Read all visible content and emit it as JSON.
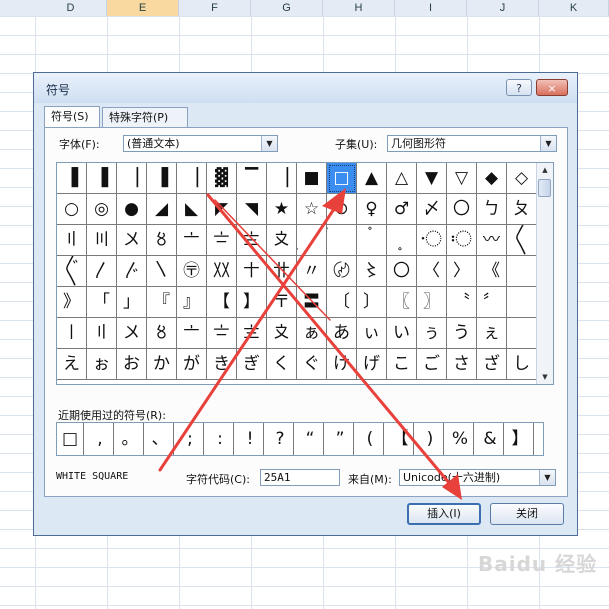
{
  "spreadsheet": {
    "columns": [
      "D",
      "E",
      "F",
      "G",
      "H",
      "I",
      "J",
      "K"
    ],
    "selected_column": "E"
  },
  "dialog": {
    "title": "符号",
    "help_button": "?",
    "close_button": "×"
  },
  "tabs": [
    {
      "label": "符号(S)",
      "active": true
    },
    {
      "label": "特殊字符(P)",
      "active": false
    }
  ],
  "font": {
    "label": "字体(F):",
    "value": "(普通文本)"
  },
  "subset": {
    "label": "子集(U):",
    "value": "几何图形符"
  },
  "symbol_grid": {
    "rows": [
      [
        "▐",
        "▐",
        "▕",
        "▐",
        "▕",
        "▓",
        "▔",
        "▕",
        "■",
        "□",
        "▲",
        "△",
        "▼",
        "▽",
        "◆",
        "◇"
      ],
      [
        "○",
        "◎",
        "●",
        "◢",
        "◣",
        "◤",
        "◥",
        "★",
        "☆",
        "⊙",
        "♀",
        "♂",
        "〆",
        "〇",
        "ㄅ",
        "ㄆ"
      ],
      [
        "〢",
        "〣",
        "〤",
        "〥",
        "〦",
        "〧",
        "〨",
        "〩",
        "〪",
        "〫",
        "〬",
        "〭",
        "〮",
        "〯",
        "〰",
        "〱"
      ],
      [
        "〲",
        "〳",
        "〴",
        "〵",
        "〶",
        "〷",
        "〸",
        "〹",
        "〃",
        "〄",
        "〻",
        "〇",
        "〈",
        "〉",
        "《",
        ""
      ],
      [
        "》",
        "「",
        "」",
        "『",
        "』",
        "【",
        "】",
        "〒",
        "〓",
        "〔",
        "〕",
        "〖",
        "〗",
        "〝",
        "〞",
        ""
      ],
      [
        "〡",
        "〢",
        "〤",
        "〥",
        "〦",
        "〧",
        "〨",
        "〩",
        "ぁ",
        "あ",
        "ぃ",
        "い",
        "ぅ",
        "う",
        "ぇ",
        ""
      ],
      [
        "え",
        "ぉ",
        "お",
        "か",
        "が",
        "き",
        "ぎ",
        "く",
        "ぐ",
        "け",
        "げ",
        "こ",
        "ご",
        "さ",
        "ざ",
        "し"
      ]
    ],
    "selected": "□"
  },
  "recent": {
    "label": "近期使用过的符号(R):",
    "symbols": [
      "□",
      ",",
      "。",
      "、",
      ";",
      ":",
      "!",
      "?",
      "“",
      "”",
      "(",
      "【",
      ")",
      "%",
      "&",
      "】"
    ]
  },
  "symbol_name": "WHITE SQUARE",
  "char_code": {
    "label": "字符代码(C):",
    "value": "25A1"
  },
  "from": {
    "label": "来自(M):",
    "value": "Unicode(十六进制)"
  },
  "buttons": {
    "insert": "插入(I)",
    "close": "关闭"
  },
  "watermark": "Baidu 经验",
  "colors": {
    "selection": "#3b8ef0",
    "annotation": "#e8413b",
    "dialog_bg": "#dde8f5"
  }
}
